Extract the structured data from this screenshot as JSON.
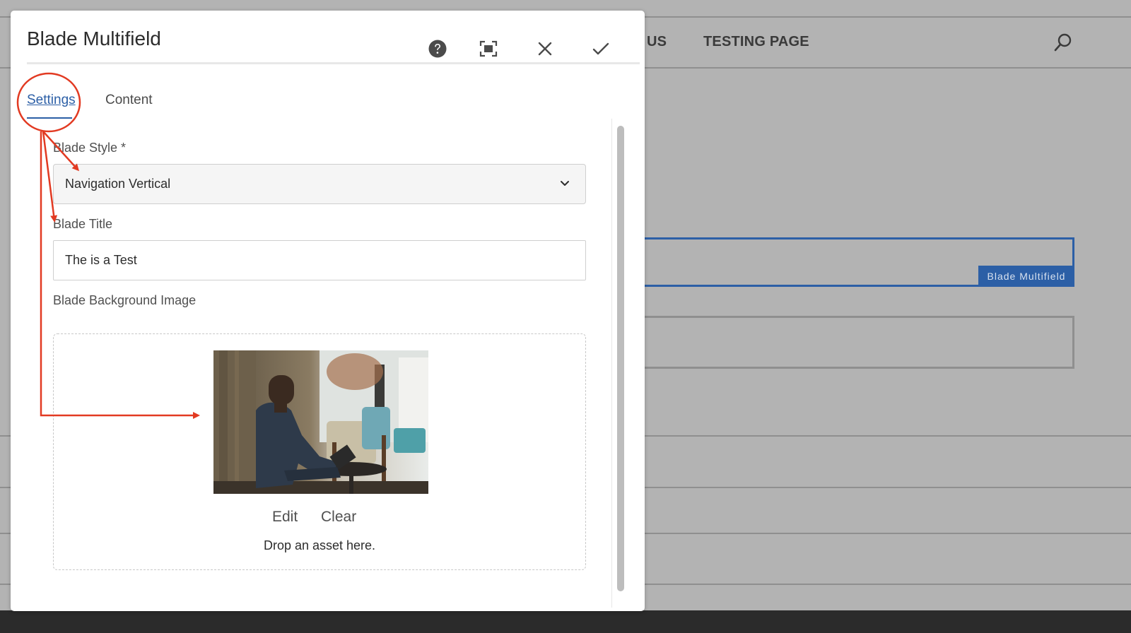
{
  "background": {
    "nav_items": [
      "US",
      "TESTING PAGE"
    ],
    "component_badge": "Blade Multifield"
  },
  "dialog": {
    "title": "Blade Multifield",
    "header_buttons": {
      "help": "help-icon",
      "fullscreen": "fullscreen-icon",
      "close": "close-icon",
      "done": "checkmark-icon"
    },
    "tabs": [
      {
        "label": "Settings",
        "active": true
      },
      {
        "label": "Content",
        "active": false
      }
    ],
    "fields": {
      "blade_style": {
        "label": "Blade Style *",
        "value": "Navigation Vertical"
      },
      "blade_title": {
        "label": "Blade Title",
        "value": "The is a Test"
      },
      "background_image": {
        "label": "Blade Background Image",
        "edit_label": "Edit",
        "clear_label": "Clear",
        "drop_hint": "Drop an asset here."
      }
    }
  },
  "colors": {
    "accent": "#2c5fa6",
    "annotation": "#e23a22",
    "overlay": "#b3b3b3"
  }
}
